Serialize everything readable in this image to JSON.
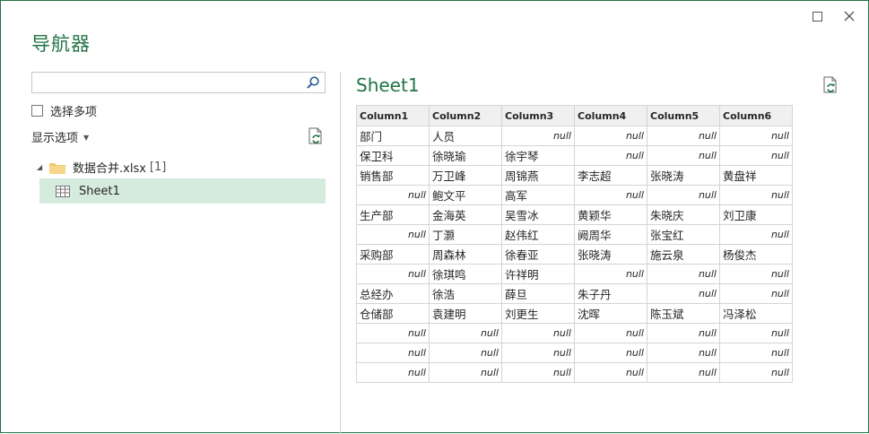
{
  "window": {
    "title": "导航器"
  },
  "left_panel": {
    "search_placeholder": "",
    "multi_select_label": "选择多项",
    "display_options_label": "显示选项",
    "tree": {
      "file_name": "数据合并.xlsx",
      "file_count": "[1]",
      "sheet_name": "Sheet1"
    }
  },
  "preview": {
    "title": "Sheet1",
    "columns": [
      "Column1",
      "Column2",
      "Column3",
      "Column4",
      "Column5",
      "Column6"
    ],
    "rows": [
      [
        "部门",
        "人员",
        "null",
        "null",
        "null",
        "null"
      ],
      [
        "保卫科",
        "徐晓瑜",
        "徐宇琴",
        "null",
        "null",
        "null"
      ],
      [
        "销售部",
        "万卫峰",
        "周锦燕",
        "李志超",
        "张晓涛",
        "黄盘祥"
      ],
      [
        "null",
        "鲍文平",
        "高军",
        "null",
        "null",
        "null"
      ],
      [
        "生产部",
        "金海英",
        "吴雪冰",
        "黄颖华",
        "朱晓庆",
        "刘卫康"
      ],
      [
        "null",
        "丁灏",
        "赵伟红",
        "阙周华",
        "张宝红",
        "null"
      ],
      [
        "采购部",
        "周森林",
        "徐春亚",
        "张晓涛",
        "施云泉",
        "杨俊杰"
      ],
      [
        "null",
        "徐琪鸣",
        "许祥明",
        "null",
        "null",
        "null"
      ],
      [
        "总经办",
        "徐浩",
        "薛旦",
        "朱子丹",
        "null",
        "null"
      ],
      [
        "仓储部",
        "袁建明",
        "刘更生",
        "沈晖",
        "陈玉斌",
        "冯泽松"
      ],
      [
        "null",
        "null",
        "null",
        "null",
        "null",
        "null"
      ],
      [
        "null",
        "null",
        "null",
        "null",
        "null",
        "null"
      ],
      [
        "null",
        "null",
        "null",
        "null",
        "null",
        "null"
      ]
    ]
  },
  "colors": {
    "accent": "#217346",
    "selected_bg": "#d5ebdd"
  },
  "icons": [
    "maximize-icon",
    "close-icon",
    "search-icon",
    "refresh-icon",
    "folder-icon",
    "table-icon",
    "chevron-down-icon",
    "expand-triangle-icon"
  ]
}
